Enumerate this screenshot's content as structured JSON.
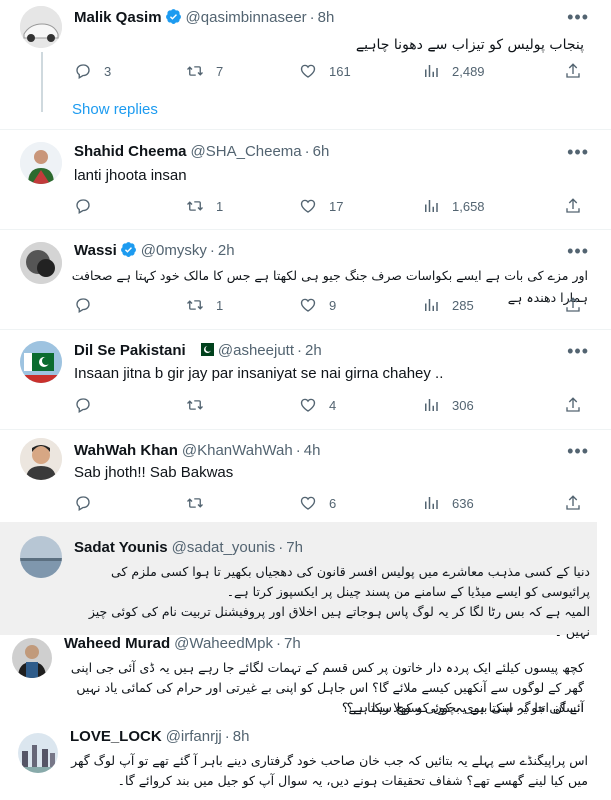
{
  "tweets": [
    {
      "name": "Malik Qasim",
      "handle": "@qasimbinnaseer",
      "time": "8h",
      "body": "پنجاب پولیس کو تیزاب سے دھونا چاہیے",
      "replies": "3",
      "retweets": "7",
      "likes": "161",
      "views": "2,489"
    },
    {
      "name": "Shahid Cheema",
      "handle": "@SHA_Cheema",
      "time": "6h",
      "body": "lanti jhoota insan",
      "replies": "",
      "retweets": "1",
      "likes": "17",
      "views": "1,658"
    },
    {
      "name": "Wassi",
      "handle": "@0mysky",
      "time": "2h",
      "body": "اور مزے کی بات ہے ایسے بکواسات صرف جنگ جیو ہی لکھتا ہے جس کا مالک خود کہتا ہے صحافت ہمارا دھندہ ہے",
      "replies": "",
      "retweets": "1",
      "likes": "9",
      "views": "285"
    },
    {
      "name": "Dil Se Pakistani",
      "handle": "@asheejutt",
      "time": "2h",
      "body": "Insaan jitna b gir jay par insaniyat se nai girna chahey ..",
      "replies": "",
      "retweets": "",
      "likes": "4",
      "views": "306"
    },
    {
      "name": "WahWah Khan",
      "handle": "@KhanWahWah",
      "time": "4h",
      "body": "Sab jhoth!! Sab Bakwas",
      "replies": "",
      "retweets": "",
      "likes": "6",
      "views": "636"
    },
    {
      "name": "Sadat Younis",
      "handle": "@sadat_younis",
      "time": "7h",
      "body1": "دنیا کے کسی مذہب معاشرے میں پولیس افسر قانون کی دھجیاں بکھیر تا ہوا کسی ملزم کی پرائیوسی کو ایسے میڈیا کے سامنے من پسند چینل پر ایکسپوز کرتا ہے۔",
      "body2": "المیہ ہے کہ بس رٹا لگا کر یہ لوگ پاس ہوجاتے ہیں اخلاق اور پروفیشنل تربیت نام کی کوئی چیز نہیں ۔"
    },
    {
      "name": "Waheed Murad",
      "handle": "@WaheedMpk",
      "time": "7h",
      "body1": "کچھ پیسوں کیلئے ایک پردہ دار خاتون پر کس قسم کے تہمات لگائے جا رہے ہیں یہ ڈی آئی جی اپنی گھر کے لوگوں سے آنکھیں کیسے ملائے گا؟ اس جاہل کو اپنی بے غیرتی اور حرام کی کمائی یاد نہیں آئے گی جو یہ اپنی بیوی بچوں کو کھلا رہا ہے؟",
      "body2": "انسان اتنا گر سکتا ہے یہ کوئی سوچ سکتا ہے؟"
    },
    {
      "name": "LOVE_LOCK",
      "handle": "@irfanrjj",
      "time": "8h",
      "body": "اس پراپیگنڈے سے پہلے یہ بتائیں کہ جب خان صاحب خود گرفتاری دینے باہر آ گئے تھے تو آپ لوگ گھر میں کیا لینے گھسے تھے؟ شفاف تحقیقات ہونے دیں، یہ سوال آپ کو جیل میں بند کروائے گا۔"
    }
  ],
  "show_replies": "Show replies",
  "colors": {
    "accent": "#1d9bf0",
    "muted": "#536471",
    "text": "#0f1419",
    "verified": "#1d9bf0"
  }
}
